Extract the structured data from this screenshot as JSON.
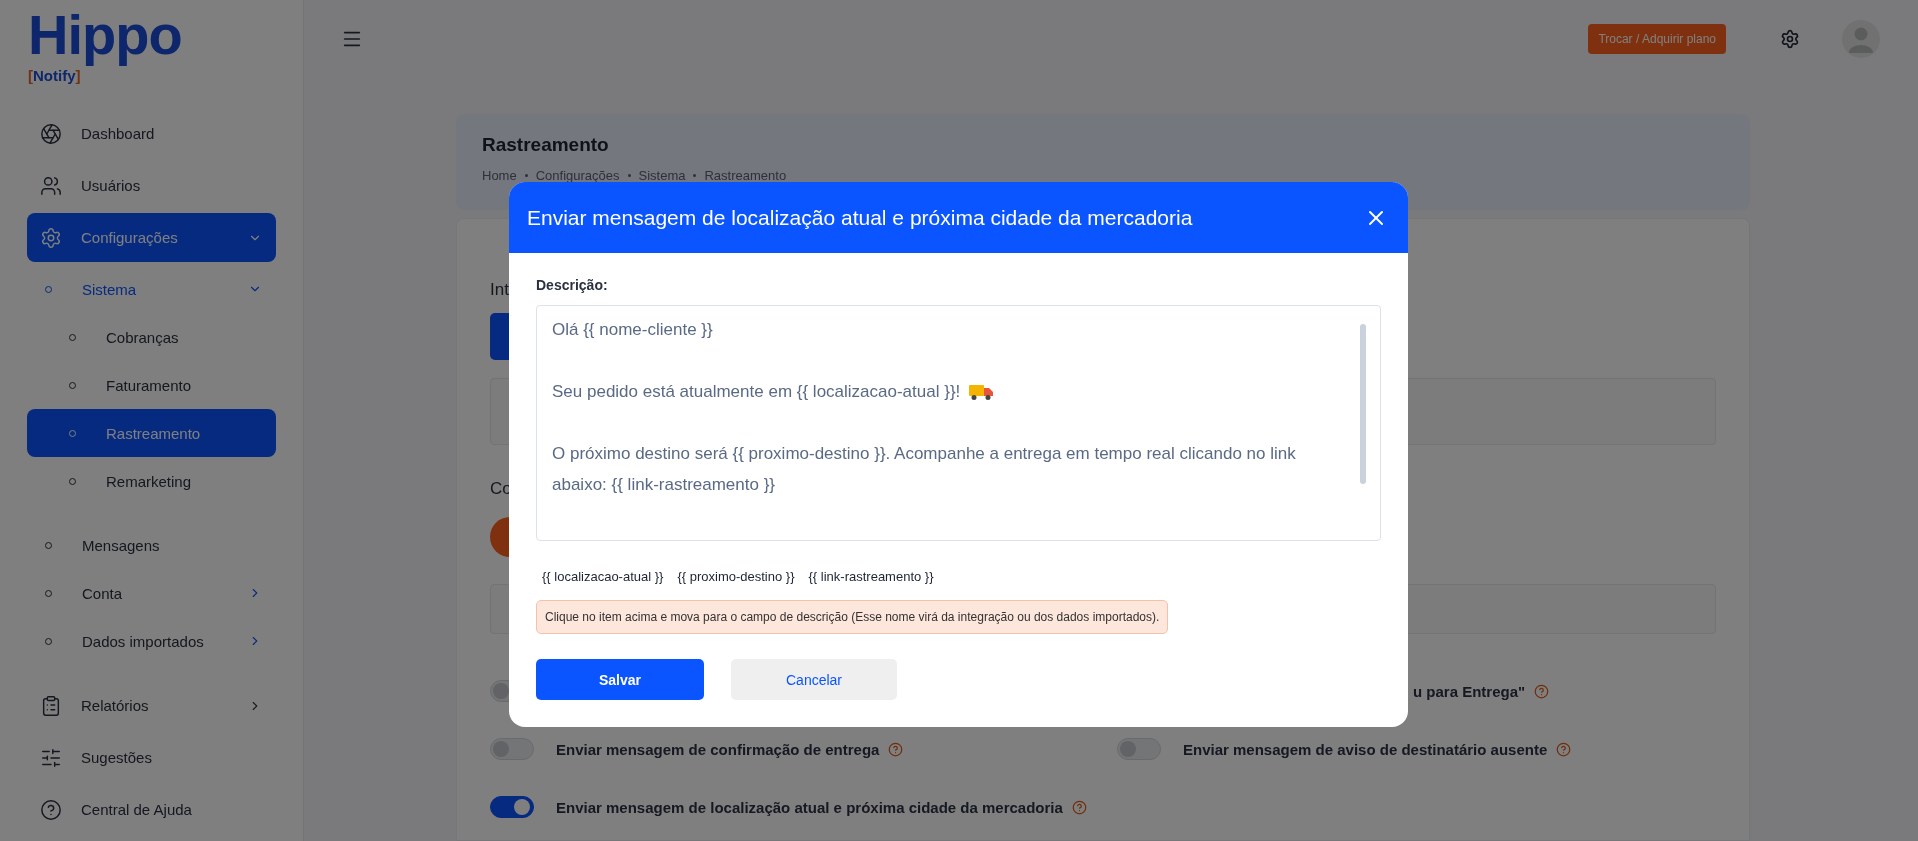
{
  "logo": {
    "name": "Hippo",
    "tagline": "[Notify]"
  },
  "sidebar": {
    "items": [
      {
        "label": "Dashboard",
        "selected": false
      },
      {
        "label": "Usuários",
        "selected": false
      },
      {
        "label": "Configurações",
        "selected": true,
        "expanded": true,
        "children": [
          {
            "label": "Sistema",
            "selected": true,
            "expanded": true,
            "children": [
              {
                "label": "Cobranças",
                "selected": false
              },
              {
                "label": "Faturamento",
                "selected": false
              },
              {
                "label": "Rastreamento",
                "selected": true
              },
              {
                "label": "Remarketing",
                "selected": false
              }
            ]
          },
          {
            "label": "Mensagens",
            "selected": false
          },
          {
            "label": "Conta",
            "selected": false,
            "expanded": false
          },
          {
            "label": "Dados importados",
            "selected": false,
            "expanded": false
          }
        ]
      },
      {
        "label": "Relatórios",
        "selected": false,
        "expanded": false
      },
      {
        "label": "Sugestões",
        "selected": false
      },
      {
        "label": "Central de Ajuda",
        "selected": false
      }
    ]
  },
  "header": {
    "plan_button": "Trocar / Adquirir plano"
  },
  "page_header": {
    "title": "Rastreamento",
    "breadcrumb": [
      "Home",
      "Configurações",
      "Sistema",
      "Rastreamento"
    ]
  },
  "content": {
    "section_1_title": "Int",
    "section_2_title": "Co",
    "toggles": [
      {
        "on": false
      },
      {
        "label": "u para Entrega\"",
        "kind": "cut"
      },
      {
        "label": "Enviar mensagem de confirmação de entrega",
        "on": false
      },
      {
        "label": "Enviar mensagem de aviso de destinatário ausente",
        "on": false
      },
      {
        "label": "Enviar mensagem de localização atual e próxima cidade da mercadoria",
        "on": true
      }
    ]
  },
  "modal": {
    "title": "Enviar mensagem de localização atual e próxima cidade da mercadoria",
    "field_label": "Descrição:",
    "message": [
      {
        "text": "Olá {{ nome-cliente }}",
        "kind": "plain"
      },
      {
        "text": "Seu pedido está atualmente em {{ localizacao-atual }}!",
        "kind": "with_icon"
      },
      {
        "text": "O próximo destino será {{ proximo-destino }}. Acompanhe a entrega em tempo real clicando no link abaixo: {{ link-rastreamento }}",
        "kind": "plain"
      }
    ],
    "variables": [
      "{{ localizacao-atual }}",
      "{{ proximo-destino }}",
      "{{ link-rastreamento }}"
    ],
    "hint": "Clique no item acima e mova para o campo de descrição (Esse nome virá da integração ou dos dados importados).",
    "save_button": "Salvar",
    "cancel_button": "Cancelar"
  }
}
